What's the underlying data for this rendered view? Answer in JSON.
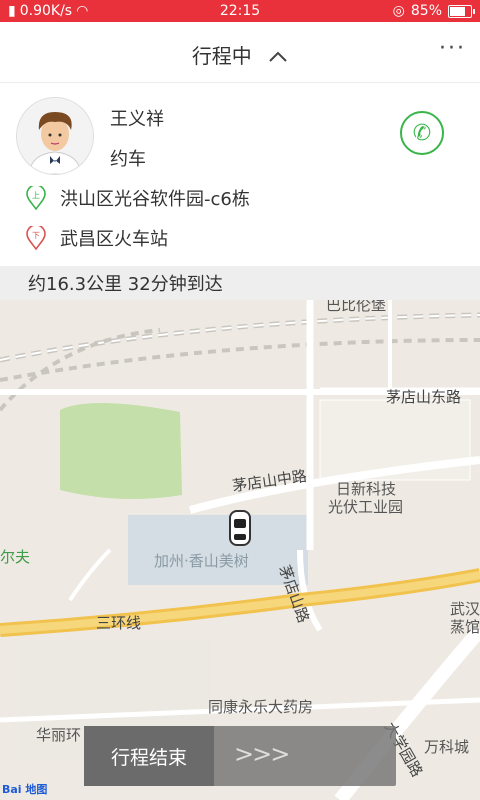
{
  "status": {
    "speed": "0.90K/s",
    "time": "22:15",
    "battery": "85%",
    "battery_level": 0.85
  },
  "header": {
    "title": "行程中",
    "title_caret": "^",
    "more": "···"
  },
  "driver": {
    "name": "王义祥",
    "type": "约车",
    "phone_icon": "phone-icon"
  },
  "route": {
    "start_badge": "上",
    "start": "洪山区光谷软件园-c6栋",
    "end_badge": "下",
    "end": "武昌区火车站"
  },
  "trip": {
    "summary": "约16.3公里  32分钟到达"
  },
  "map": {
    "labels": {
      "top": "巴比伦堡",
      "maodianshan_east": "茅店山东路",
      "maodianshan_mid": "茅店山中路",
      "rixin": "日新科技",
      "guangfu": "光伏工业园",
      "jiazhou": "加州·香山美树",
      "golf": "尔夫",
      "maodianshan_road": "茅店山路",
      "sanhuan": "三环线",
      "wuhan": "武汉",
      "zhengguan": "蒸馆",
      "tongkang": "同康永乐大药房",
      "huali": "华丽环",
      "vanke": "万科城",
      "daxue": "大学园路",
      "baidu": "Bai 地图"
    }
  },
  "footer": {
    "end_trip": "行程结束",
    "arrows": ">>>"
  }
}
